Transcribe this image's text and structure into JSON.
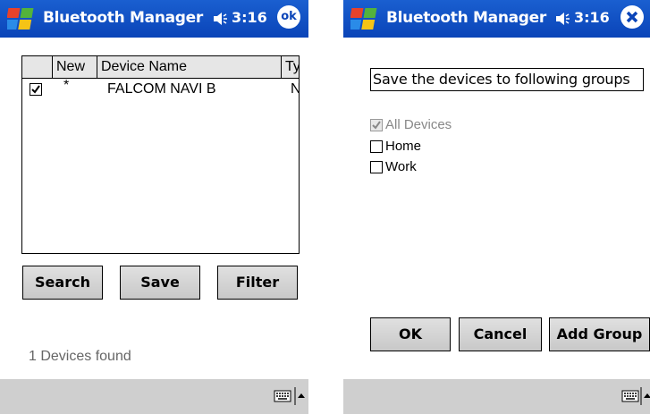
{
  "colors": {
    "titlebar": "#0a44b8",
    "bottombar": "#cfcfcf",
    "disabled_text": "#888888"
  },
  "left": {
    "title": "Bluetooth Manager",
    "time": "3:16",
    "ok_label": "ok",
    "table": {
      "columns": [
        "New",
        "Device Name",
        "Ty"
      ],
      "rows": [
        {
          "checked": true,
          "new": "*",
          "name": "FALCOM NAVI B",
          "type": "N"
        }
      ]
    },
    "buttons": {
      "search": "Search",
      "save": "Save",
      "filter": "Filter"
    },
    "status": "1 Devices found"
  },
  "right": {
    "title": "Bluetooth Manager",
    "time": "3:16",
    "prompt": "Save the devices to following groups",
    "groups": [
      {
        "label": "All Devices",
        "checked": true,
        "disabled": true
      },
      {
        "label": "Home",
        "checked": false,
        "disabled": false
      },
      {
        "label": "Work",
        "checked": false,
        "disabled": false
      }
    ],
    "buttons": {
      "ok": "OK",
      "cancel": "Cancel",
      "add_group": "Add Group"
    }
  }
}
